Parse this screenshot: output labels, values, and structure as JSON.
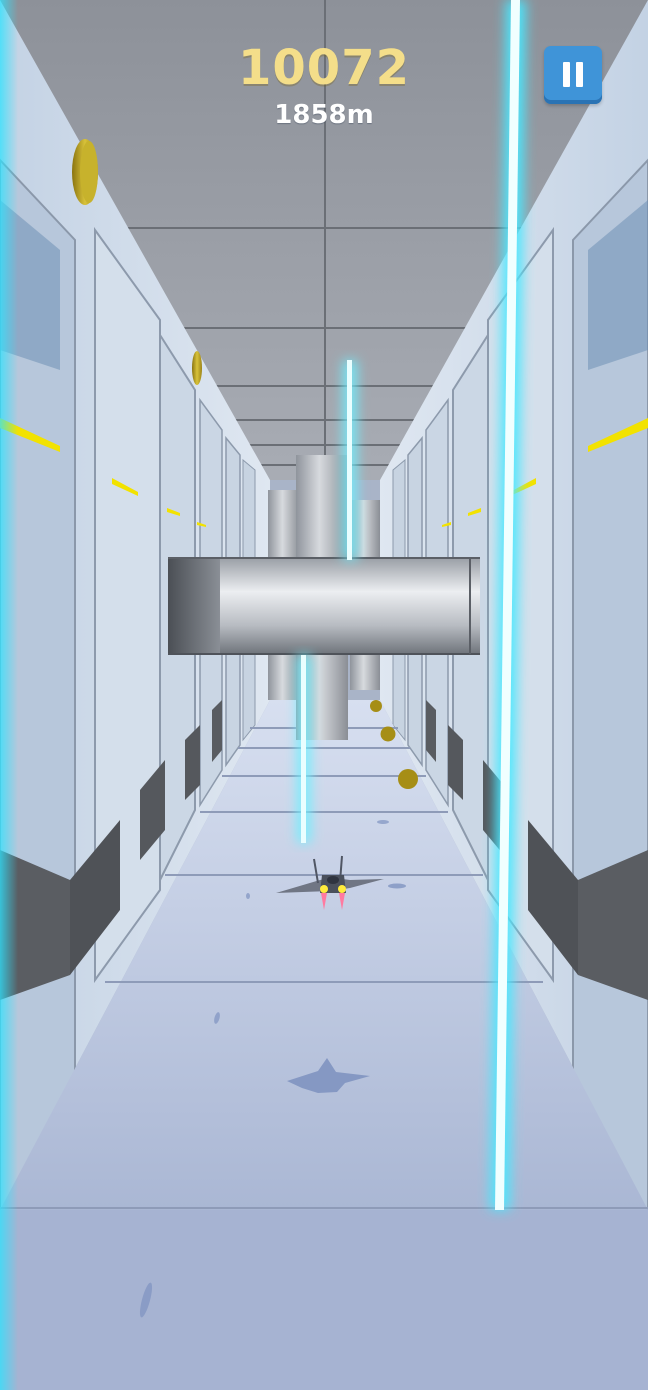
{
  "hud": {
    "score": "10072",
    "distance": "1858m"
  },
  "pause_button": {
    "icon": "pause-icon",
    "color": "#3f94d8"
  },
  "colors": {
    "laser": "#7ff3ff",
    "coin": "#b79d1a",
    "accent_light": "#f2e200",
    "floor": "#b6c2dc"
  }
}
